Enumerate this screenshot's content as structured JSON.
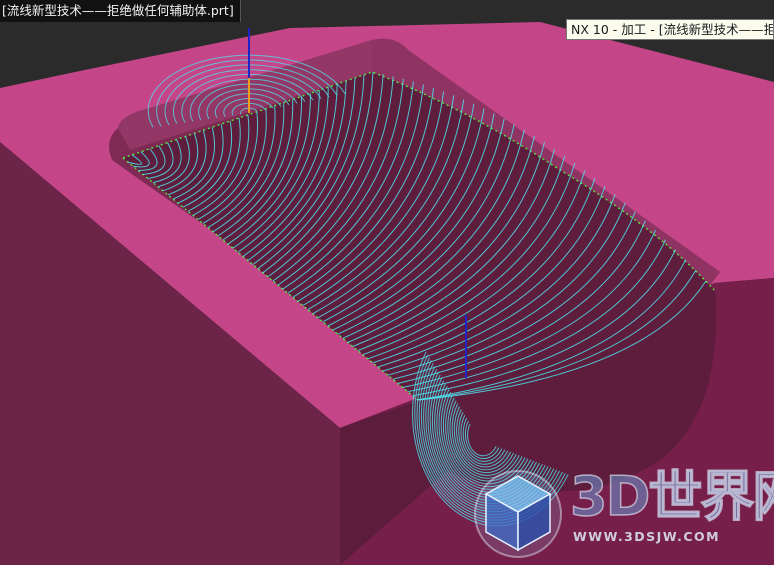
{
  "window": {
    "file_tab": "[流线新型技术——拒绝做任何辅助体.prt]",
    "tooltip": "NX 10 - 加工 - [流线新型技术——拒"
  },
  "colors": {
    "background": "#2b2b2b",
    "part_top_face": "#c54589",
    "part_side_face": "#6c2448",
    "toolpath_cut": "#4de4ee",
    "toolpath_boundary": "#55e83a",
    "tool_axis": "#1e24c8",
    "tool_tip": "#f59a1a"
  },
  "watermark": {
    "brand": "3D世界网",
    "url": "WWW.3DSJW.COM"
  }
}
